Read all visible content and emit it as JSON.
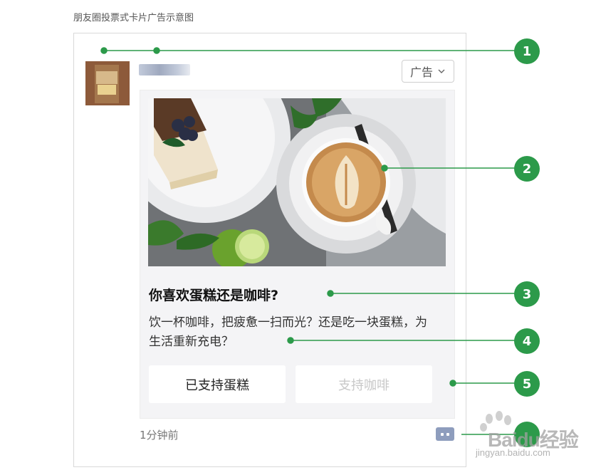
{
  "caption": "朋友圈投票式卡片广告示意图",
  "ad_tag": {
    "label": "广告"
  },
  "card": {
    "title": "你喜欢蛋糕还是咖啡?",
    "description": "饮一杯咖啡，把疲惫一扫而光？还是吃一块蛋糕，为生活重新充电？",
    "options": [
      {
        "label": "已支持蛋糕",
        "state": "selected"
      },
      {
        "label": "支持咖啡",
        "state": "disabled"
      }
    ]
  },
  "footer": {
    "time": "1分钟前"
  },
  "callouts": [
    "1",
    "2",
    "3",
    "4",
    "5"
  ],
  "watermark": {
    "text": "Baidu经验",
    "url_text": "jingyan.baidu.com"
  },
  "colors": {
    "callout_green": "#2c9a4a",
    "card_bg": "#f4f4f6",
    "comment_icon": "#8e9dbd"
  }
}
